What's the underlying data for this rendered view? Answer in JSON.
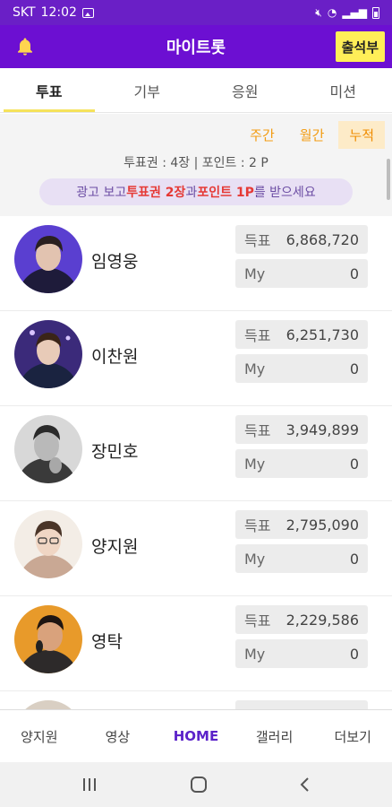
{
  "status_bar": {
    "carrier": "SKT",
    "time": "12:02"
  },
  "app_bar": {
    "title": "마이트롯",
    "checkin_label": "출석부"
  },
  "tabs": [
    {
      "label": "투표",
      "active": true
    },
    {
      "label": "기부",
      "active": false
    },
    {
      "label": "응원",
      "active": false
    },
    {
      "label": "미션",
      "active": false
    }
  ],
  "period_filters": [
    {
      "label": "주간",
      "active": false
    },
    {
      "label": "월간",
      "active": false
    },
    {
      "label": "누적",
      "active": true
    }
  ],
  "ticket_info": "투표권 : 4장 | 포인트 : 2 P",
  "ad_banner": {
    "prefix": "광고 보고 ",
    "highlight1": "투표권 2장",
    "middle": "과 ",
    "highlight2": "포인트 1P",
    "suffix": "를 받으세요"
  },
  "stat_labels": {
    "votes": "득표",
    "my": "My"
  },
  "ranking": [
    {
      "name": "임영웅",
      "votes": "6,868,720",
      "my": "0"
    },
    {
      "name": "이찬원",
      "votes": "6,251,730",
      "my": "0"
    },
    {
      "name": "장민호",
      "votes": "3,949,899",
      "my": "0"
    },
    {
      "name": "양지원",
      "votes": "2,795,090",
      "my": "0"
    },
    {
      "name": "영탁",
      "votes": "2,229,586",
      "my": "0"
    }
  ],
  "bottom_nav": [
    {
      "label": "양지원",
      "active": false
    },
    {
      "label": "영상",
      "active": false
    },
    {
      "label": "HOME",
      "active": true
    },
    {
      "label": "갤러리",
      "active": false
    },
    {
      "label": "더보기",
      "active": false
    }
  ],
  "colors": {
    "primary": "#6c0fd2",
    "accent_yellow": "#ffee58",
    "period_orange": "#f39c12",
    "highlight_red": "#e53935",
    "home_active": "#5b22c9"
  }
}
